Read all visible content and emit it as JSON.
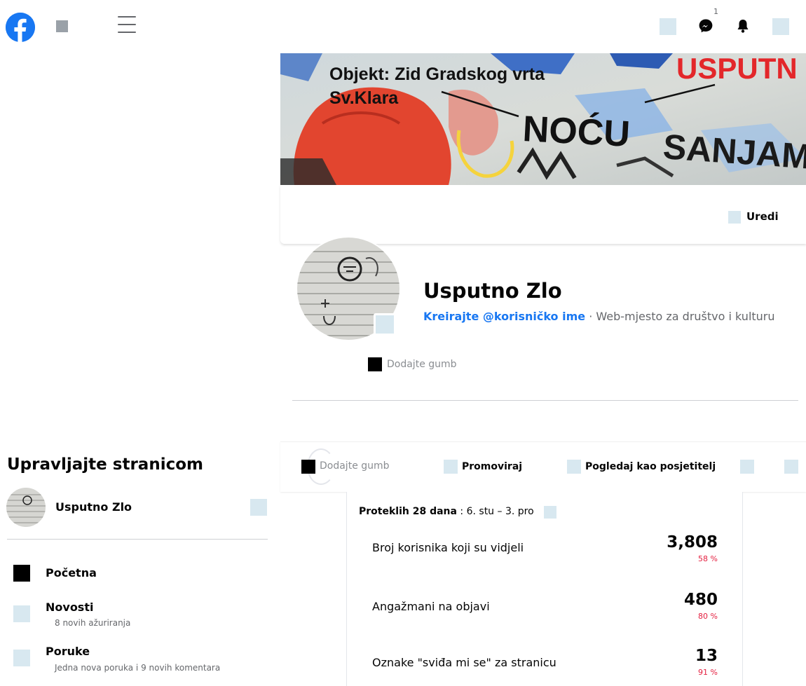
{
  "topbar": {
    "messenger_badge": "1",
    "icons": [
      "facebook-logo",
      "hamburger-menu-icon",
      "messenger-icon",
      "bell-icon"
    ]
  },
  "cover": {
    "line1": "Objekt: Zid Gradskog vrta",
    "line2": "Sv.Klara",
    "brand": "USPUTN",
    "graffiti1": "NOĆU",
    "graffiti2": "SANJAM",
    "edit_label": "Uredi"
  },
  "profile": {
    "name": "Usputno Zlo",
    "username_link": "Kreirajte @korisničko ime",
    "category": " · Web-mjesto za društvo i kulturu",
    "add_button_label": "Dodajte gumb"
  },
  "sidebar": {
    "title": "Upravljajte stranicom",
    "page_name": "Usputno Zlo",
    "items": [
      {
        "label": "Početna",
        "sub": ""
      },
      {
        "label": "Novosti",
        "sub": "8 novih ažuriranja"
      },
      {
        "label": "Poruke",
        "sub": "Jedna nova poruka i 9 novih komentara"
      }
    ]
  },
  "tabs": {
    "add_button": "Dodajte gumb",
    "promote": "Promoviraj",
    "view_as_visitor": "Pogledaj kao posjetitelj"
  },
  "stats": {
    "period_label": "Proteklih 28 dana",
    "period_range": " : 6. stu – 3. pro",
    "rows": [
      {
        "label": "Broj korisnika koji su vidjeli",
        "value": "3,808",
        "pct": "58 %"
      },
      {
        "label": "Angažmani na objavi",
        "value": "480",
        "pct": "80 %"
      },
      {
        "label": "Oznake \"sviđa mi se\" za stranicu",
        "value": "13",
        "pct": "91 %"
      }
    ]
  },
  "colors": {
    "brand_blue": "#1877f2",
    "negative_red": "#e41e3f",
    "placeholder": "#d8e8f0"
  }
}
